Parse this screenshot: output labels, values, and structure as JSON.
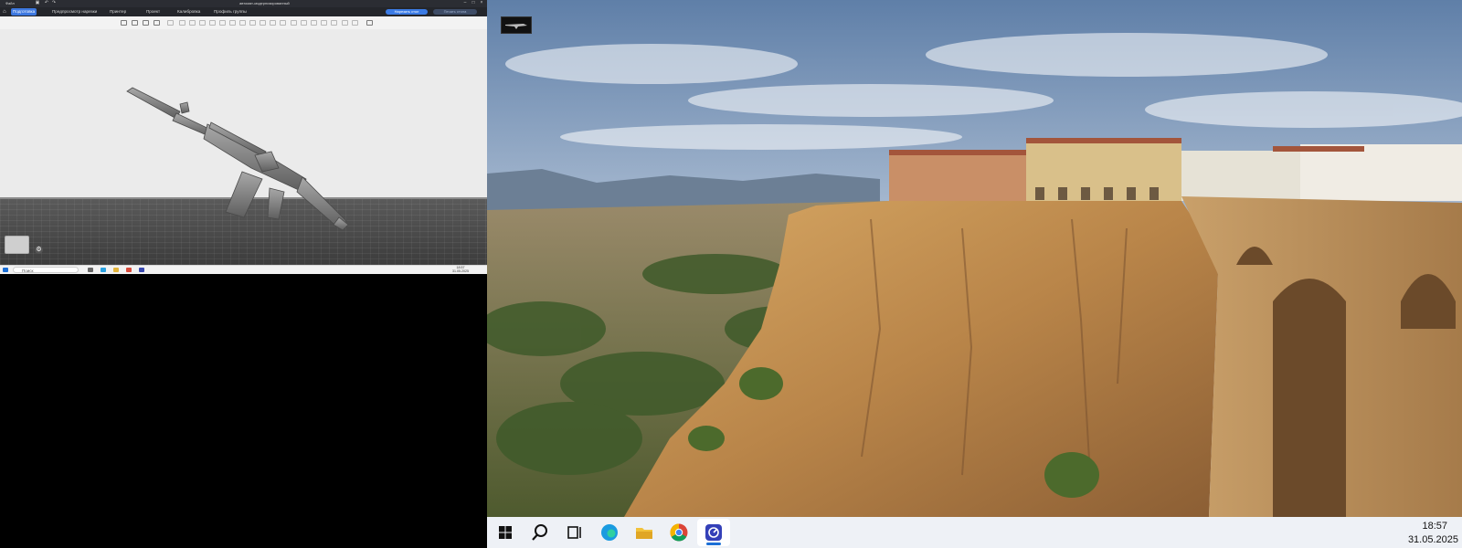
{
  "left_screen": {
    "title_bar": {
      "app_menu": "Файл",
      "project_title": "автомат-модернизированный"
    },
    "menu_tabs": [
      {
        "label": "Подготовка",
        "active": true
      },
      {
        "label": "Предпросмотр нарезки",
        "active": false
      },
      {
        "label": "Принтер",
        "active": false
      },
      {
        "label": "Проект",
        "active": false
      },
      {
        "label": "Калибровка",
        "active": false
      },
      {
        "label": "Профиль группы",
        "active": false
      }
    ],
    "slice_button": "Нарезать стол",
    "print_button": "Печать стола",
    "taskbar": {
      "search_placeholder": "Поиск",
      "clock_time": "18:57",
      "clock_date": "31.05.2025"
    },
    "accent_color": "#3d78e0"
  },
  "right_screen": {
    "desktop_icon": {
      "name": "rifle-model-shortcut-icon"
    },
    "taskbar": {
      "buttons": [
        {
          "name": "start-button"
        },
        {
          "name": "search-button"
        },
        {
          "name": "task-view-button"
        },
        {
          "name": "edge-browser-button"
        },
        {
          "name": "file-explorer-button"
        },
        {
          "name": "chrome-browser-button"
        },
        {
          "name": "slicer-app-button",
          "active": true
        }
      ],
      "clock_time": "18:57",
      "clock_date": "31.05.2025"
    }
  }
}
